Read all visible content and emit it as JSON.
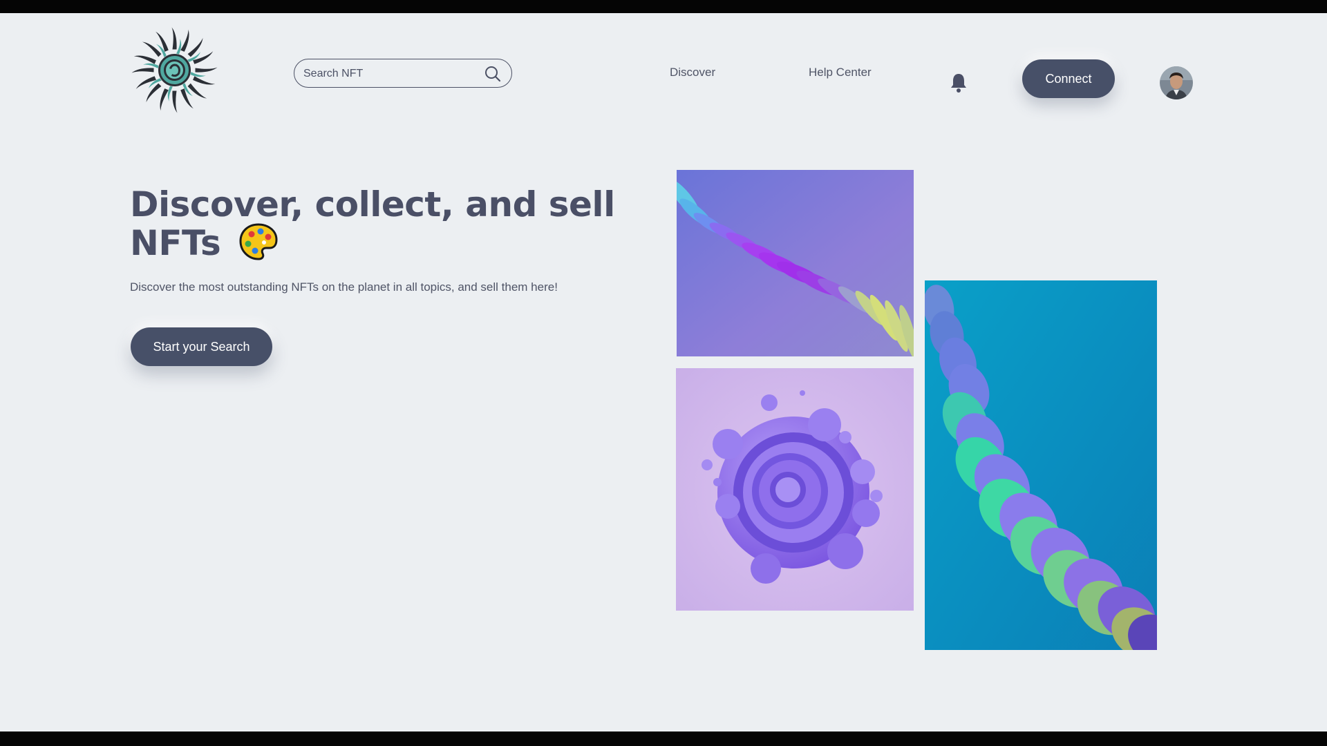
{
  "header": {
    "search": {
      "placeholder": "Search NFT",
      "icon": "search-icon"
    },
    "nav": {
      "discover": "Discover",
      "help_center": "Help Center"
    },
    "notifications_icon": "bell-icon",
    "connect_label": "Connect",
    "avatar": "user-avatar"
  },
  "hero": {
    "title_line1": "Discover, collect, and sell",
    "title_line2": "NFTs",
    "title_icon": "palette-icon",
    "subtitle": "Discover the most outstanding NFTs on the planet in all topics, and sell them here!",
    "cta_label": "Start your Search"
  },
  "gallery": [
    {
      "name": "purple-ribbon-art"
    },
    {
      "name": "purple-swirl-art"
    },
    {
      "name": "teal-wave-art"
    }
  ],
  "colors": {
    "background": "#eceff2",
    "primary_button": "#475068",
    "text_dark": "#4a4f66"
  }
}
